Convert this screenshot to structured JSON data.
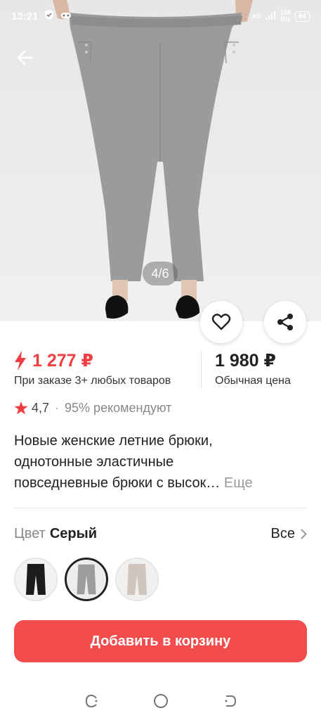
{
  "status_bar": {
    "time": "13:21",
    "network": "4G",
    "speed_value": "104",
    "speed_unit": "B/s",
    "battery": "64"
  },
  "gallery": {
    "counter": "4/6"
  },
  "price": {
    "promo_price": "1 277 ₽",
    "promo_note": "При заказе 3+ любых товаров",
    "regular_price": "1 980 ₽",
    "regular_note": "Обычная цена",
    "promo_color": "#ef3e41"
  },
  "rating": {
    "value": "4,7",
    "separator": "·",
    "recommend": "95% рекомендуют"
  },
  "product": {
    "title_lines": [
      "Новые женские летние брюки,",
      "однотонные эластичные",
      "повседневные брюки с высок…"
    ],
    "more": "Еще"
  },
  "color": {
    "label": "Цвет",
    "selected": "Серый",
    "all": "Все",
    "options": [
      "black-pants",
      "gray-pants",
      "beige-pants"
    ]
  },
  "actions": {
    "add_to_cart": "Добавить в корзину",
    "accent": "#f24c4c"
  }
}
